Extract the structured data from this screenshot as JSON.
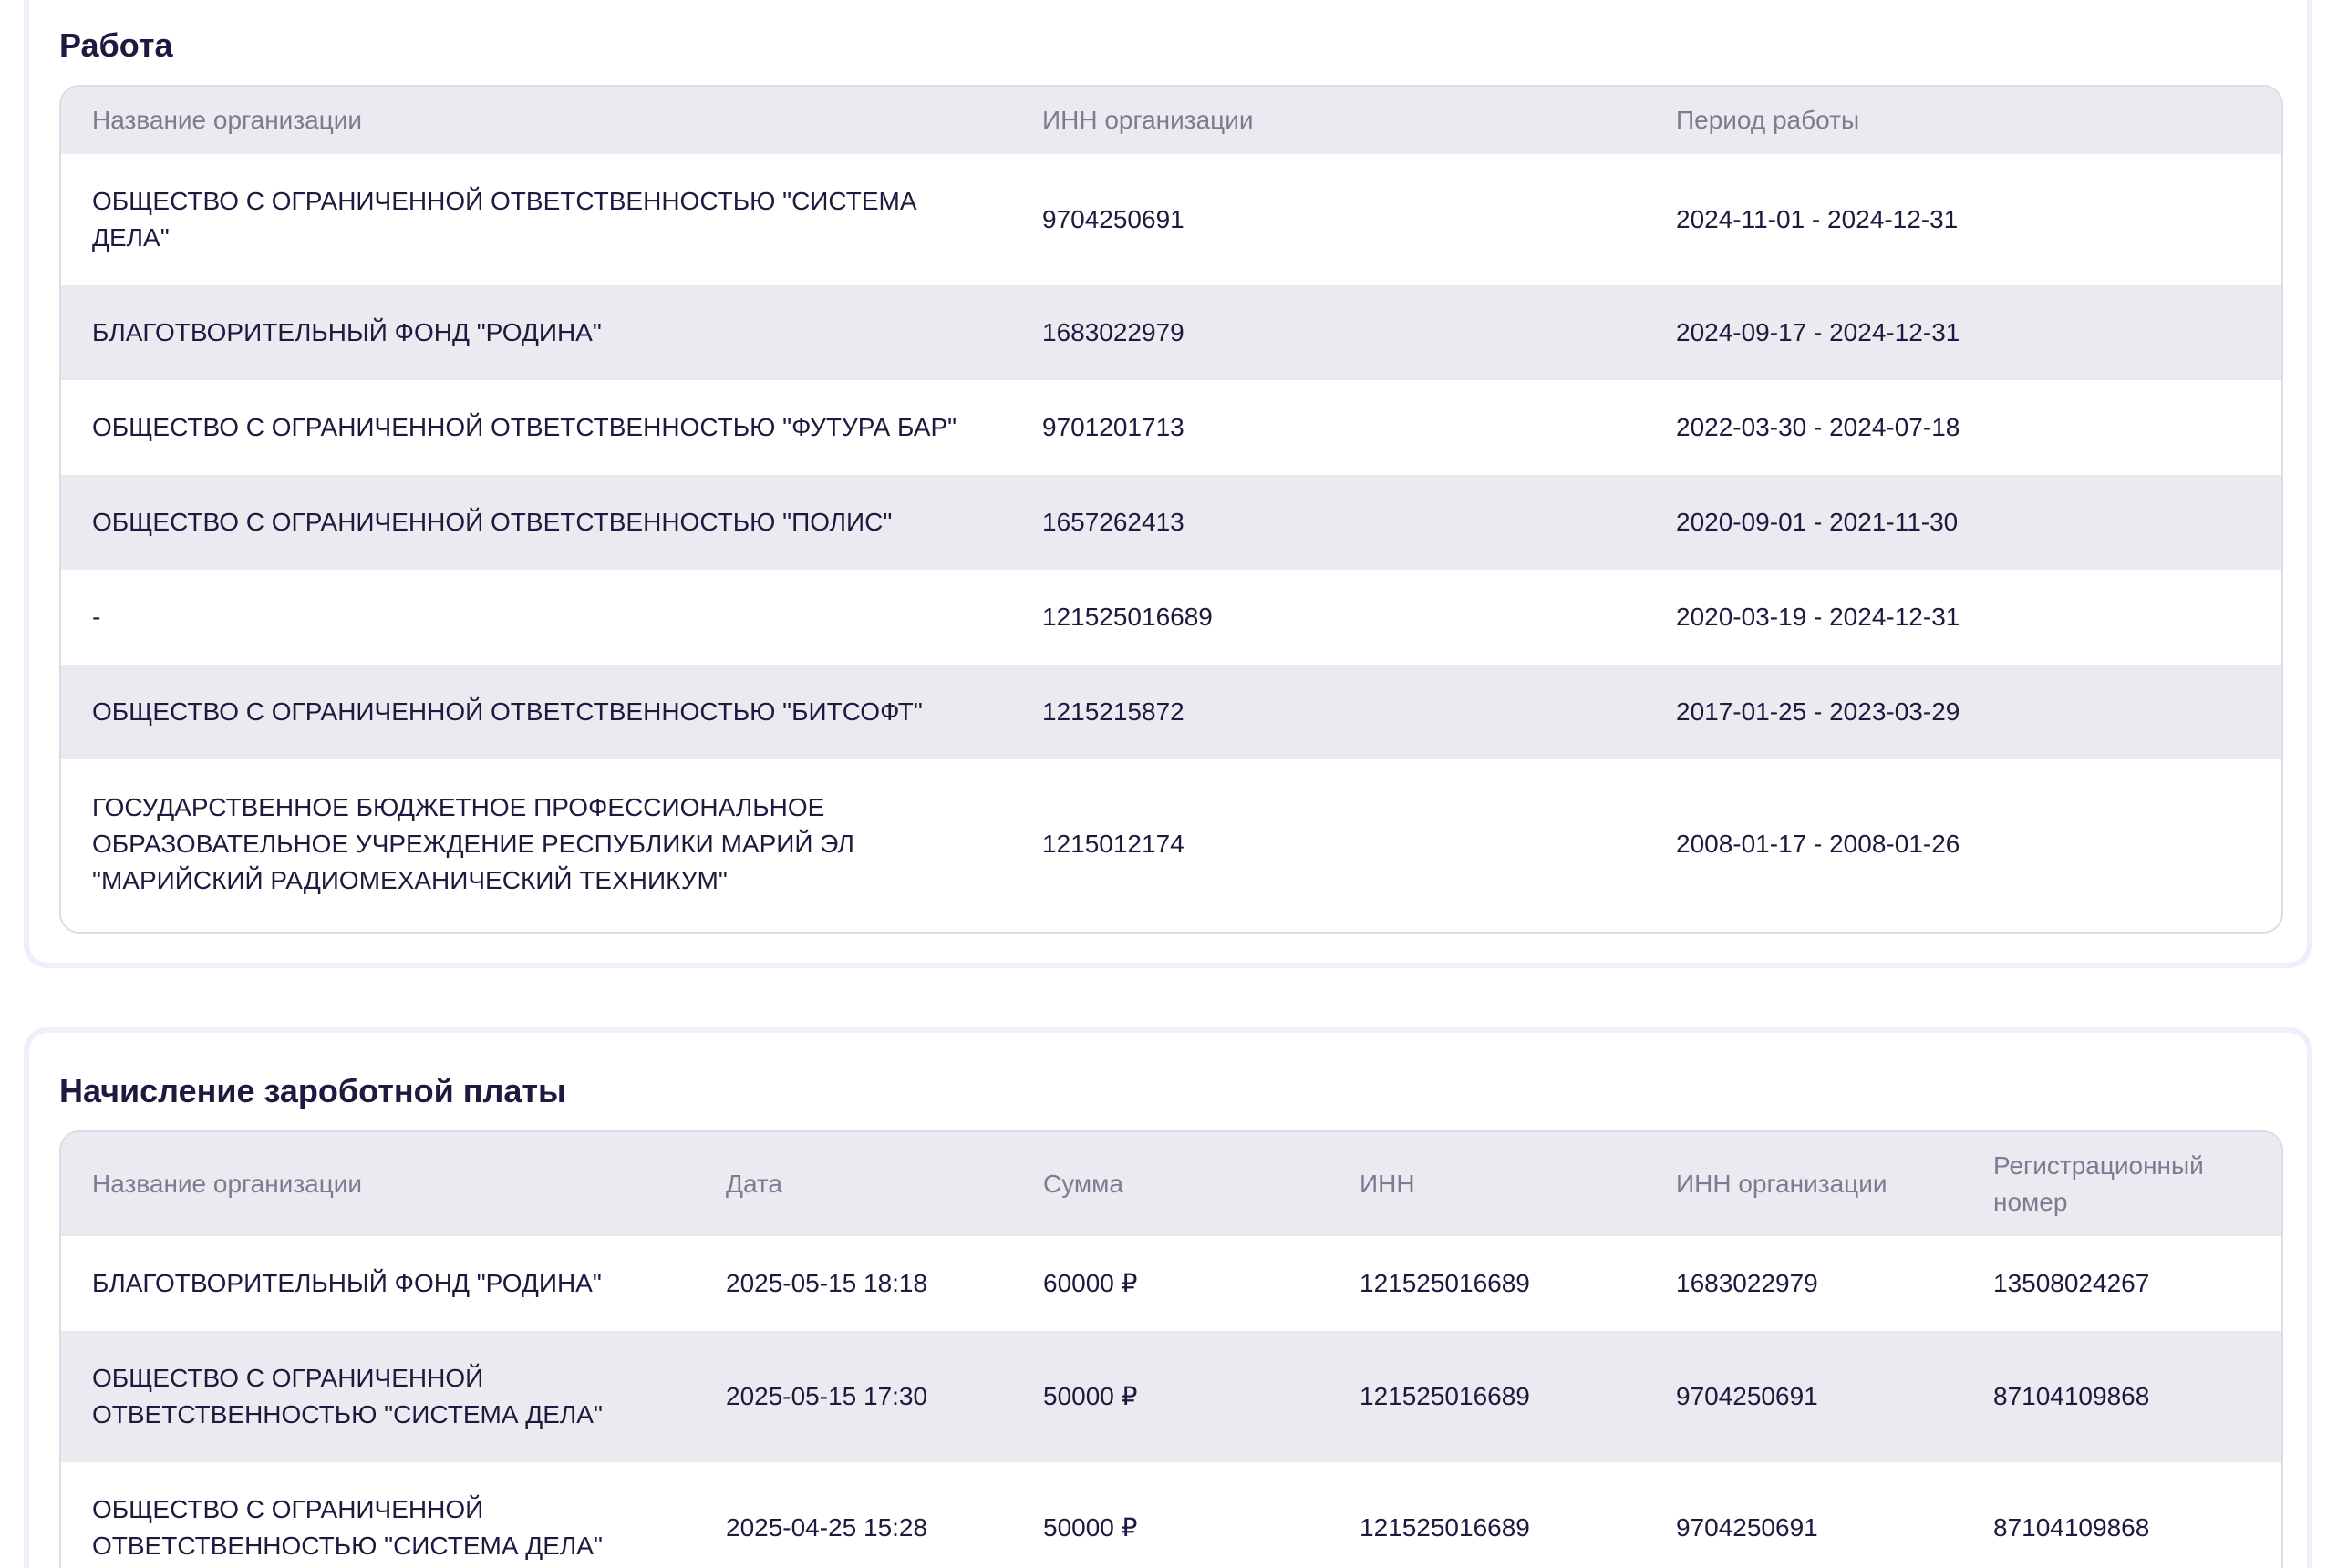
{
  "work": {
    "title": "Работа",
    "columns": [
      "Название организации",
      "ИНН организации",
      "Период работы"
    ],
    "rows": [
      {
        "org": "ОБЩЕСТВО С ОГРАНИЧЕННОЙ ОТВЕТСТВЕННОСТЬЮ \"СИСТЕМА ДЕЛА\"",
        "inn": "9704250691",
        "period": "2024-11-01 - 2024-12-31"
      },
      {
        "org": "БЛАГОТВОРИТЕЛЬНЫЙ ФОНД \"РОДИНА\"",
        "inn": "1683022979",
        "period": "2024-09-17 - 2024-12-31"
      },
      {
        "org": "ОБЩЕСТВО С ОГРАНИЧЕННОЙ ОТВЕТСТВЕННОСТЬЮ \"ФУТУРА БАР\"",
        "inn": "9701201713",
        "period": "2022-03-30 - 2024-07-18"
      },
      {
        "org": "ОБЩЕСТВО С ОГРАНИЧЕННОЙ ОТВЕТСТВЕННОСТЬЮ \"ПОЛИС\"",
        "inn": "1657262413",
        "period": "2020-09-01 - 2021-11-30"
      },
      {
        "org": "-",
        "inn": "121525016689",
        "period": "2020-03-19 - 2024-12-31"
      },
      {
        "org": "ОБЩЕСТВО С ОГРАНИЧЕННОЙ ОТВЕТСТВЕННОСТЬЮ \"БИТСОФТ\"",
        "inn": "1215215872",
        "period": "2017-01-25 - 2023-03-29"
      },
      {
        "org": "ГОСУДАРСТВЕННОЕ БЮДЖЕТНОЕ ПРОФЕССИОНАЛЬНОЕ ОБРАЗОВАТЕЛЬНОЕ УЧРЕЖДЕНИЕ РЕСПУБЛИКИ МАРИЙ ЭЛ \"МАРИЙСКИЙ РАДИОМЕХАНИЧЕСКИЙ ТЕХНИКУМ\"",
        "inn": "1215012174",
        "period": "2008-01-17 - 2008-01-26"
      }
    ]
  },
  "salary": {
    "title": "Начисление зароботной платы",
    "columns": [
      "Название организации",
      "Дата",
      "Сумма",
      "ИНН",
      "ИНН организации",
      "Регистрационный номер"
    ],
    "rows": [
      {
        "org": "БЛАГОТВОРИТЕЛЬНЫЙ ФОНД \"РОДИНА\"",
        "date": "2025-05-15 18:18",
        "amount": "60000 ₽",
        "inn": "121525016689",
        "org_inn": "1683022979",
        "reg_no": "13508024267"
      },
      {
        "org": "ОБЩЕСТВО С ОГРАНИЧЕННОЙ ОТВЕТСТВЕННОСТЬЮ \"СИСТЕМА ДЕЛА\"",
        "date": "2025-05-15 17:30",
        "amount": "50000 ₽",
        "inn": "121525016689",
        "org_inn": "9704250691",
        "reg_no": "87104109868"
      },
      {
        "org": "ОБЩЕСТВО С ОГРАНИЧЕННОЙ ОТВЕТСТВЕННОСТЬЮ \"СИСТЕМА ДЕЛА\"",
        "date": "2025-04-25 15:28",
        "amount": "50000 ₽",
        "inn": "121525016689",
        "org_inn": "9704250691",
        "reg_no": "87104109868"
      }
    ]
  }
}
